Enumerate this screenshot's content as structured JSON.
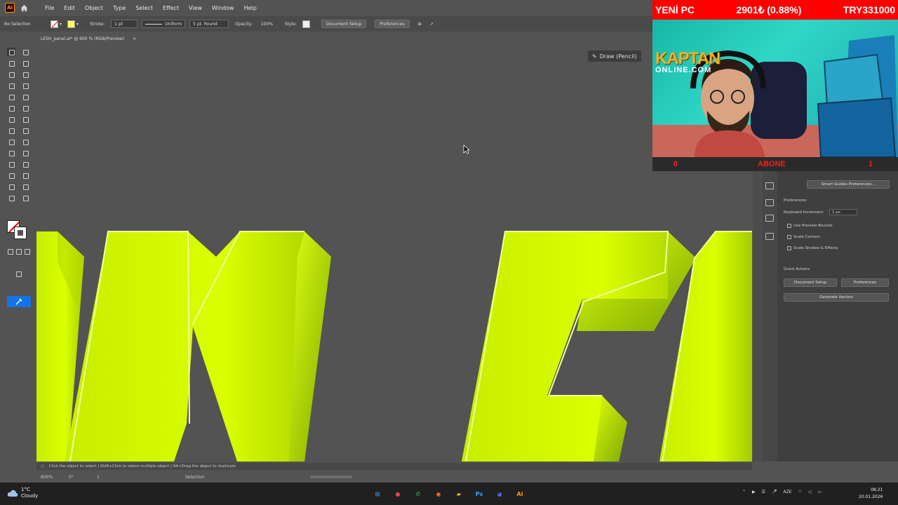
{
  "app": {
    "badge": "Ai",
    "menu": [
      "File",
      "Edit",
      "Object",
      "Type",
      "Select",
      "Effect",
      "View",
      "Window",
      "Help"
    ]
  },
  "control_bar": {
    "selection_state": "No Selection",
    "stroke_label": "Stroke:",
    "stroke_weight": "1 pt",
    "profile": "Uniform",
    "brush": "5 pt. Round",
    "opacity_label": "Opacity:",
    "opacity_value": "100%",
    "style_label": "Style:",
    "document_setup": "Document Setup",
    "preferences": "Preferences"
  },
  "document": {
    "tab_title": "LESH_panel.ai* @ 600 % (RGB/Preview)",
    "close": "×"
  },
  "canvas": {
    "draw_mode_label": "Draw (Pencil)",
    "art_color": "#d7ff00"
  },
  "status": {
    "hint": "Click the object to select  |  Shift+Click to select multiple object  |  Alt+Drag the object to duplicate",
    "zoom": "600%",
    "rotation": "0°",
    "artboard": "1",
    "tool": "Selection"
  },
  "properties_panel": {
    "smart_guides_button": "Smart Guides Preferences...",
    "preferences_heading": "Preferences",
    "keyboard_increment_label": "Keyboard Increment:",
    "keyboard_increment_value": "1 px",
    "use_preview_bounds": "Use Preview Bounds",
    "scale_corners": "Scale Corners",
    "scale_strokes": "Scale Strokes & Effects",
    "quick_actions_heading": "Quick Actions",
    "document_setup_button": "Document Setup",
    "preferences_button": "Preferences",
    "generate_vectors_button": "Generate Vectors"
  },
  "stream_overlay": {
    "bar_left": "YENİ PC",
    "bar_mid": "2901₺ (0.88%)",
    "bar_right": "TRY331000",
    "logo_main": "KAPTAN",
    "logo_sub": "ONLINE.COM",
    "footer_left": "0",
    "footer_mid": "ABONE",
    "footer_right": "1",
    "bar_color": "#ff0000"
  },
  "taskbar": {
    "temperature": "1°C",
    "condition": "Cloudy",
    "language": "AZE",
    "time": "08:21",
    "date": "20.01.2026",
    "apps": [
      {
        "name": "windows-start-icon",
        "glyph": "⊞",
        "color": "#2b9af3"
      },
      {
        "name": "chrome-icon",
        "glyph": "●",
        "color": "#e8453c"
      },
      {
        "name": "whatsapp-icon",
        "glyph": "✆",
        "color": "#25d366"
      },
      {
        "name": "blender-icon",
        "glyph": "◉",
        "color": "#f5792a"
      },
      {
        "name": "file-explorer-icon",
        "glyph": "▰",
        "color": "#f2c028"
      },
      {
        "name": "photoshop-icon",
        "glyph": "Ps",
        "color": "#31a8ff"
      },
      {
        "name": "discord-icon",
        "glyph": "◕",
        "color": "#5865f2"
      },
      {
        "name": "illustrator-icon",
        "glyph": "Ai",
        "color": "#ff9a00"
      }
    ]
  }
}
